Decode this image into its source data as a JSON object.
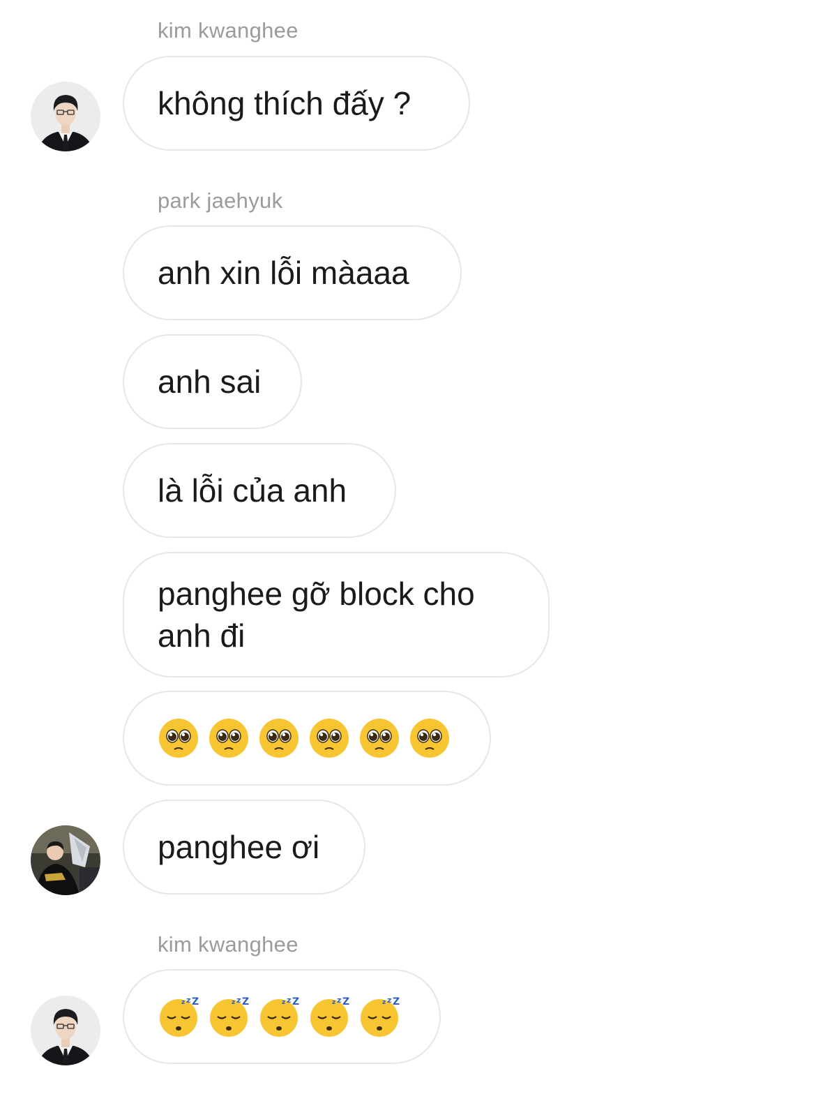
{
  "messages": [
    {
      "sender": "kim kwanghee",
      "text": "không thích đấy ?"
    },
    {
      "sender": "park jaehyuk",
      "text": "anh xin lỗi màaaa"
    },
    {
      "text": "anh sai"
    },
    {
      "text": "là lỗi của anh"
    },
    {
      "text": "panghee gỡ block cho anh đi"
    },
    {
      "emoji": "pleading-face",
      "count": 6
    },
    {
      "text": "panghee ơi"
    },
    {
      "sender": "kim kwanghee",
      "emoji": "sleeping-face",
      "count": 5
    }
  ],
  "colors": {
    "bubble_border": "#e6e6e6",
    "sender_text": "#9b9b9b",
    "message_text": "#1a1a1a",
    "emoji_yellow": "#f7c531",
    "zzz_blue": "#2f5fbf"
  },
  "avatars": {
    "kim_kwanghee": "man-in-suit-avatar",
    "park_jaehyuk": "trophy-photo-avatar"
  }
}
